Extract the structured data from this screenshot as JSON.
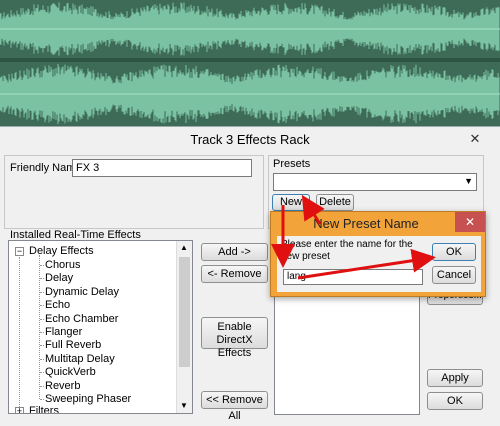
{
  "colors": {
    "waveform": "#7ac2a2",
    "background": "#3e6b58",
    "dialog_bg": "#f0f0f0",
    "accent_orange": "#f2a33a",
    "close_red": "#c75050",
    "annotation_red": "#e01010"
  },
  "dialog": {
    "title": "Track 3 Effects Rack",
    "friendly_name_label": "Friendly Name",
    "friendly_name_value": "FX 3",
    "presets_label": "Presets",
    "presets_selected": "",
    "new_button": "New",
    "delete_button": "Delete",
    "installed_label": "Installed Real-Time Effects",
    "tree": {
      "group": "Delay Effects",
      "items": [
        "Chorus",
        "Delay",
        "Dynamic Delay",
        "Echo",
        "Echo Chamber",
        "Flanger",
        "Full Reverb",
        "Multitap Delay",
        "QuickVerb",
        "Reverb",
        "Sweeping Phaser"
      ],
      "next_group": "Filters"
    },
    "add_button": "Add ->",
    "remove_button": "<- Remove",
    "enable_directx_button": "Enable DirectX Effects",
    "remove_all_button": "<< Remove All",
    "properties_button": "Properties...",
    "apply_button": "Apply",
    "ok_button": "OK"
  },
  "preset_dialog": {
    "title": "New Preset Name",
    "prompt": "Please enter the name for the new preset",
    "input_value": "lang",
    "ok_button": "OK",
    "cancel_button": "Cancel"
  }
}
